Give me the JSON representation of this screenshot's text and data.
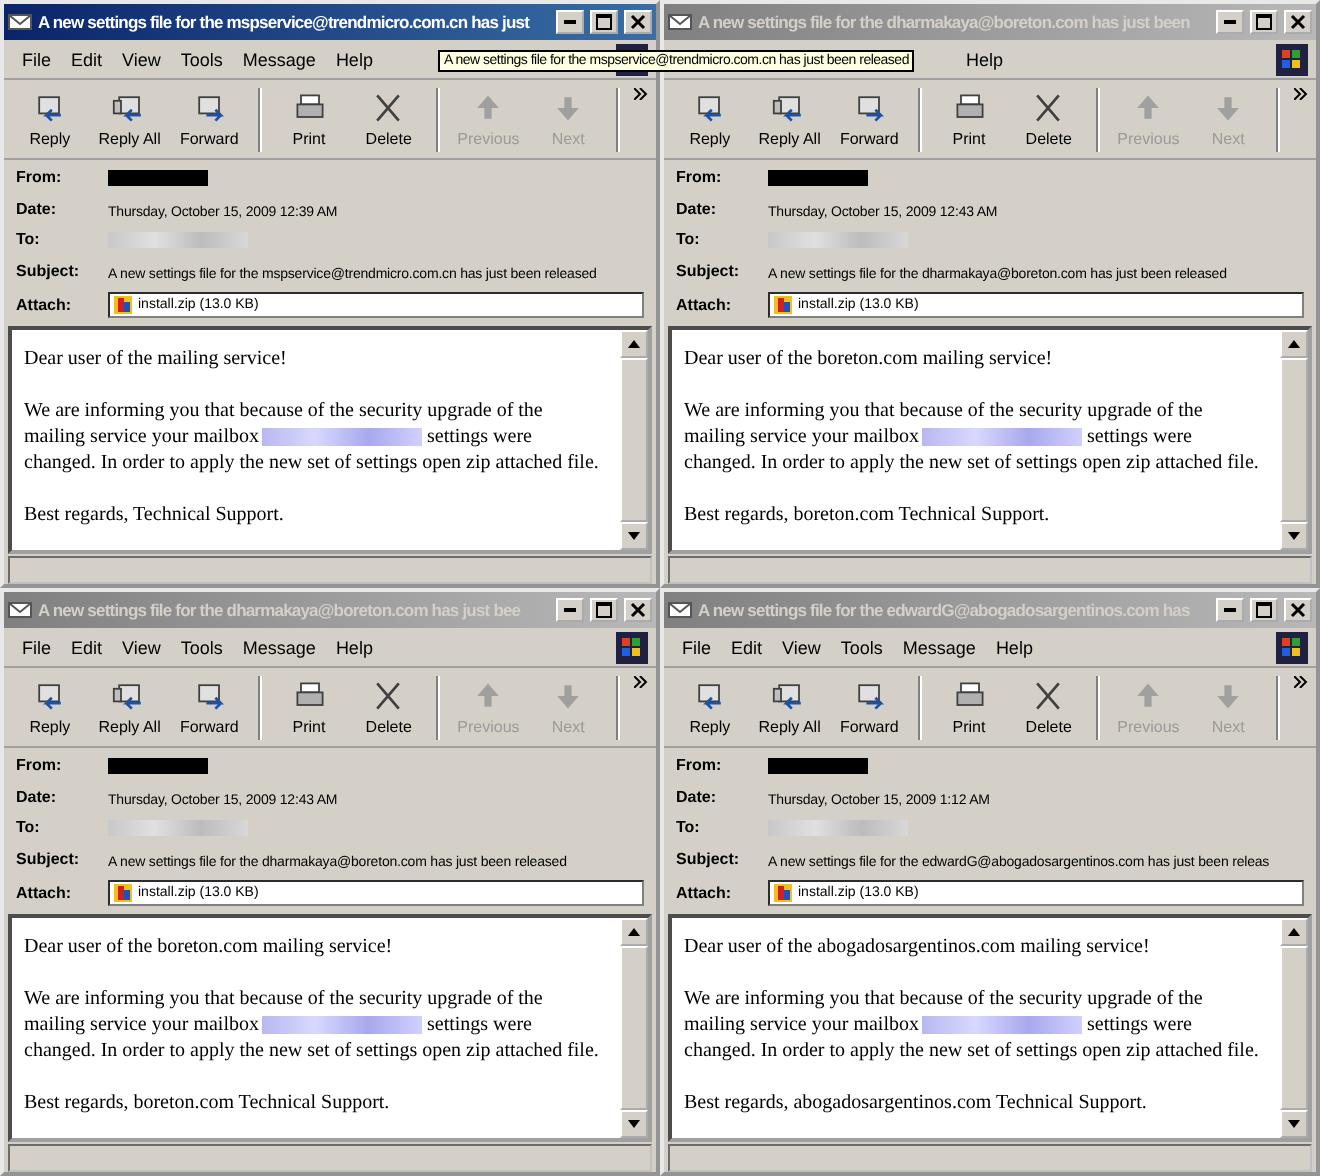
{
  "tooltip": "A new settings file for the mspservice@trendmicro.com.cn has just been released",
  "windows": [
    {
      "title": "A new settings file for the mspservice@trendmicro.com.cn has just",
      "active": true,
      "menu": [
        {
          "label": "File"
        },
        {
          "label": "Edit"
        },
        {
          "label": "View"
        },
        {
          "label": "Tools"
        },
        {
          "label": "Message"
        },
        {
          "label": "Help"
        }
      ],
      "toolbar": [
        {
          "label": "Reply",
          "kind": "reply",
          "disabled": false
        },
        {
          "label": "Reply All",
          "kind": "replyall",
          "disabled": false
        },
        {
          "label": "Forward",
          "kind": "forward",
          "disabled": false
        },
        {
          "label": "Print",
          "kind": "print",
          "disabled": false
        },
        {
          "label": "Delete",
          "kind": "delete",
          "disabled": false
        },
        {
          "label": "Previous",
          "kind": "previous",
          "disabled": true
        },
        {
          "label": "Next",
          "kind": "next",
          "disabled": true
        }
      ],
      "fields": [
        {
          "label": "From:",
          "kind": "redacted"
        },
        {
          "label": "Date:",
          "kind": "text",
          "value": "Thursday, October 15, 2009 12:39 AM"
        },
        {
          "label": "To:",
          "kind": "blurred"
        },
        {
          "label": "Subject:",
          "kind": "text",
          "value": "A new settings file for the mspservice@trendmicro.com.cn has just been released"
        },
        {
          "label": "Attach:",
          "kind": "attachment",
          "value": "install.zip (13.0 KB)"
        }
      ],
      "body": {
        "greeting": "Dear user of the mailing service!",
        "paragraph_start": "We are informing you that because of the security upgrade of the mailing service your mailbox",
        "paragraph_end": "settings were changed. In order to apply the new set of settings open zip attached file.",
        "signoff": "Best regards, Technical Support."
      }
    },
    {
      "title": "A new settings file for the dharmakaya@boreton.com has just been",
      "active": false,
      "menu_under_tooltip": true,
      "menu": [
        {
          "label": "Help"
        }
      ],
      "toolbar": [
        {
          "label": "Reply",
          "kind": "reply",
          "disabled": false
        },
        {
          "label": "Reply All",
          "kind": "replyall",
          "disabled": false
        },
        {
          "label": "Forward",
          "kind": "forward",
          "disabled": false
        },
        {
          "label": "Print",
          "kind": "print",
          "disabled": false
        },
        {
          "label": "Delete",
          "kind": "delete",
          "disabled": false
        },
        {
          "label": "Previous",
          "kind": "previous",
          "disabled": true
        },
        {
          "label": "Next",
          "kind": "next",
          "disabled": true
        }
      ],
      "fields": [
        {
          "label": "From:",
          "kind": "redacted"
        },
        {
          "label": "Date:",
          "kind": "text",
          "value": "Thursday, October 15, 2009 12:43 AM"
        },
        {
          "label": "To:",
          "kind": "blurred"
        },
        {
          "label": "Subject:",
          "kind": "text",
          "value": "A new settings file for the dharmakaya@boreton.com has just been released"
        },
        {
          "label": "Attach:",
          "kind": "attachment",
          "value": "install.zip (13.0 KB)"
        }
      ],
      "body": {
        "greeting": "Dear user of the boreton.com mailing service!",
        "paragraph_start": "We are informing you that because of the security upgrade of the mailing service your mailbox",
        "paragraph_end": "settings were changed. In order to apply the new set of settings open zip attached file.",
        "signoff": "Best regards, boreton.com Technical Support."
      }
    },
    {
      "title": "A new settings file for the dharmakaya@boreton.com has just bee",
      "active": false,
      "menu": [
        {
          "label": "File"
        },
        {
          "label": "Edit"
        },
        {
          "label": "View"
        },
        {
          "label": "Tools"
        },
        {
          "label": "Message"
        },
        {
          "label": "Help"
        }
      ],
      "toolbar": [
        {
          "label": "Reply",
          "kind": "reply",
          "disabled": false
        },
        {
          "label": "Reply All",
          "kind": "replyall",
          "disabled": false
        },
        {
          "label": "Forward",
          "kind": "forward",
          "disabled": false
        },
        {
          "label": "Print",
          "kind": "print",
          "disabled": false
        },
        {
          "label": "Delete",
          "kind": "delete",
          "disabled": false
        },
        {
          "label": "Previous",
          "kind": "previous",
          "disabled": true
        },
        {
          "label": "Next",
          "kind": "next",
          "disabled": true
        }
      ],
      "fields": [
        {
          "label": "From:",
          "kind": "redacted"
        },
        {
          "label": "Date:",
          "kind": "text",
          "value": "Thursday, October 15, 2009 12:43 AM"
        },
        {
          "label": "To:",
          "kind": "blurred"
        },
        {
          "label": "Subject:",
          "kind": "text",
          "value": "A new settings file for the dharmakaya@boreton.com has just been released"
        },
        {
          "label": "Attach:",
          "kind": "attachment",
          "value": "install.zip (13.0 KB)"
        }
      ],
      "body": {
        "greeting": "Dear user of the boreton.com mailing service!",
        "paragraph_start": "We are informing you that because of the security upgrade of the mailing service your mailbox",
        "paragraph_end": "settings were changed. In order to apply the new set of settings open zip attached file.",
        "signoff": "Best regards, boreton.com Technical Support."
      }
    },
    {
      "title": "A new settings file for the edwardG@abogadosargentinos.com has",
      "active": false,
      "menu": [
        {
          "label": "File"
        },
        {
          "label": "Edit"
        },
        {
          "label": "View"
        },
        {
          "label": "Tools"
        },
        {
          "label": "Message"
        },
        {
          "label": "Help"
        }
      ],
      "toolbar": [
        {
          "label": "Reply",
          "kind": "reply",
          "disabled": false
        },
        {
          "label": "Reply All",
          "kind": "replyall",
          "disabled": false
        },
        {
          "label": "Forward",
          "kind": "forward",
          "disabled": false
        },
        {
          "label": "Print",
          "kind": "print",
          "disabled": false
        },
        {
          "label": "Delete",
          "kind": "delete",
          "disabled": false
        },
        {
          "label": "Previous",
          "kind": "previous",
          "disabled": true
        },
        {
          "label": "Next",
          "kind": "next",
          "disabled": true
        }
      ],
      "fields": [
        {
          "label": "From:",
          "kind": "redacted"
        },
        {
          "label": "Date:",
          "kind": "text",
          "value": "Thursday, October 15, 2009 1:12 AM"
        },
        {
          "label": "To:",
          "kind": "blurred"
        },
        {
          "label": "Subject:",
          "kind": "text",
          "value": "A new settings file for the edwardG@abogadosargentinos.com has just been releas"
        },
        {
          "label": "Attach:",
          "kind": "attachment",
          "value": "install.zip (13.0 KB)"
        }
      ],
      "body": {
        "greeting": "Dear user of the abogadosargentinos.com mailing service!",
        "paragraph_start": "We are informing you that because of the security upgrade of the mailing service your mailbox",
        "paragraph_end": "settings were changed. In order to apply the new set of settings open zip attached file.",
        "signoff": "Best regards, abogadosargentinos.com Technical Support."
      }
    }
  ]
}
